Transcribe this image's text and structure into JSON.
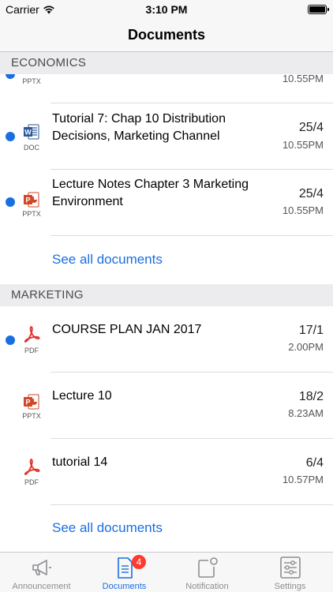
{
  "status_bar": {
    "carrier": "Carrier",
    "time": "3:10 PM"
  },
  "nav": {
    "title": "Documents"
  },
  "sections": [
    {
      "header": "ECONOMICS",
      "rows": [
        {
          "title": "",
          "type": "PPTX",
          "date": "",
          "time": "10.55PM",
          "unread": true
        },
        {
          "title": "Tutorial 7: Chap 10 Distribution Decisions, Marketing Channel",
          "type": "DOC",
          "date": "25/4",
          "time": "10.55PM",
          "unread": true
        },
        {
          "title": "Lecture Notes Chapter 3 Marketing Environment",
          "type": "PPTX",
          "date": "25/4",
          "time": "10.55PM",
          "unread": true
        }
      ],
      "see_all": "See all documents"
    },
    {
      "header": "MARKETING",
      "rows": [
        {
          "title": "COURSE PLAN JAN 2017",
          "type": "PDF",
          "date": "17/1",
          "time": "2.00PM",
          "unread": true
        },
        {
          "title": "Lecture 10",
          "type": "PPTX",
          "date": "18/2",
          "time": "8.23AM",
          "unread": false
        },
        {
          "title": "tutorial 14",
          "type": "PDF",
          "date": "6/4",
          "time": "10.57PM",
          "unread": false
        }
      ],
      "see_all": "See all documents"
    }
  ],
  "tab_bar": {
    "tabs": [
      {
        "label": "Announcement",
        "icon": "megaphone-icon"
      },
      {
        "label": "Documents",
        "icon": "document-icon",
        "badge": "4",
        "active": true
      },
      {
        "label": "Notification",
        "icon": "notification-icon"
      },
      {
        "label": "Settings",
        "icon": "sliders-icon"
      }
    ]
  },
  "colors": {
    "accent": "#1a6fe0",
    "badge": "#ff3b30",
    "pdf": "#e0302a",
    "pptx": "#d24726",
    "doc": "#2b5797"
  }
}
